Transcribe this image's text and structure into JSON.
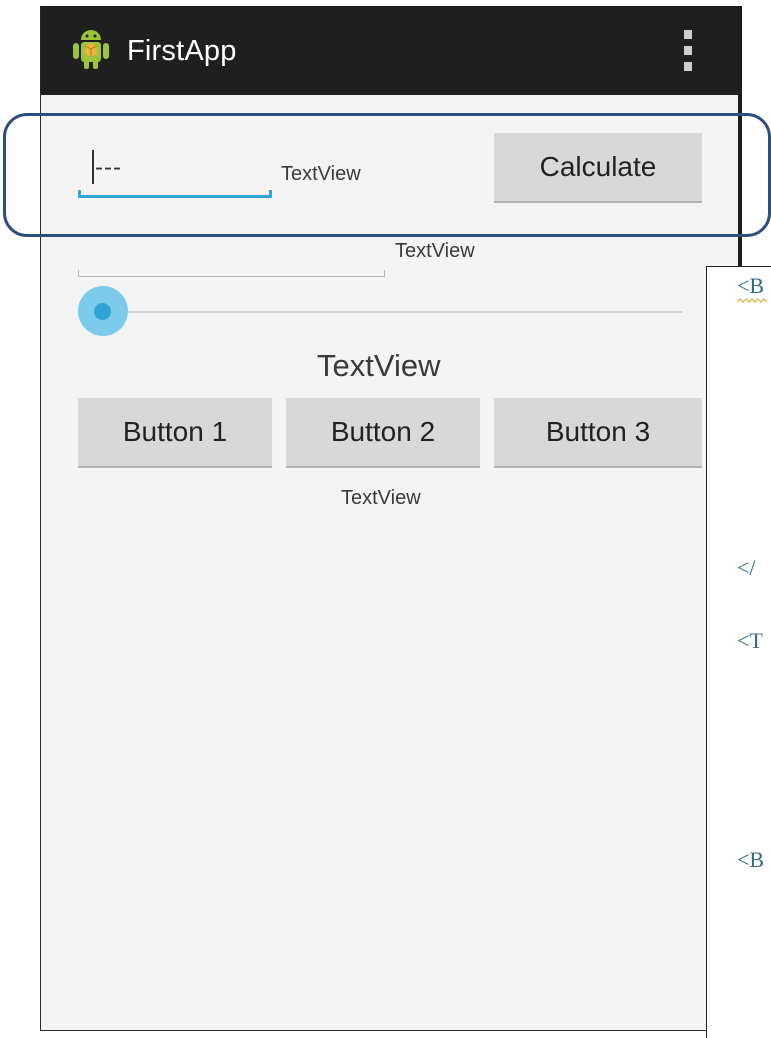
{
  "app": {
    "title": "FirstApp",
    "icon": "android-robot-icon",
    "menu_icon": "overflow-menu-icon"
  },
  "form": {
    "edit_text_value": "---",
    "textview_1": "TextView",
    "calculate_label": "Calculate",
    "textview_2": "TextView",
    "seekbar_progress": 0,
    "textview_3": "TextView",
    "buttons": [
      "Button 1",
      "Button 2",
      "Button 3"
    ],
    "textview_4": "TextView"
  },
  "code_panel": {
    "lines": [
      "<B",
      "</",
      "<T",
      "<B"
    ]
  },
  "colors": {
    "action_bar": "#1f1f1f",
    "accent": "#31a5d6",
    "highlight_border": "#2b4f7c",
    "code_text": "#2f6a8c",
    "button_bg": "#d8d8d8",
    "screen_bg": "#f4f4f4"
  }
}
